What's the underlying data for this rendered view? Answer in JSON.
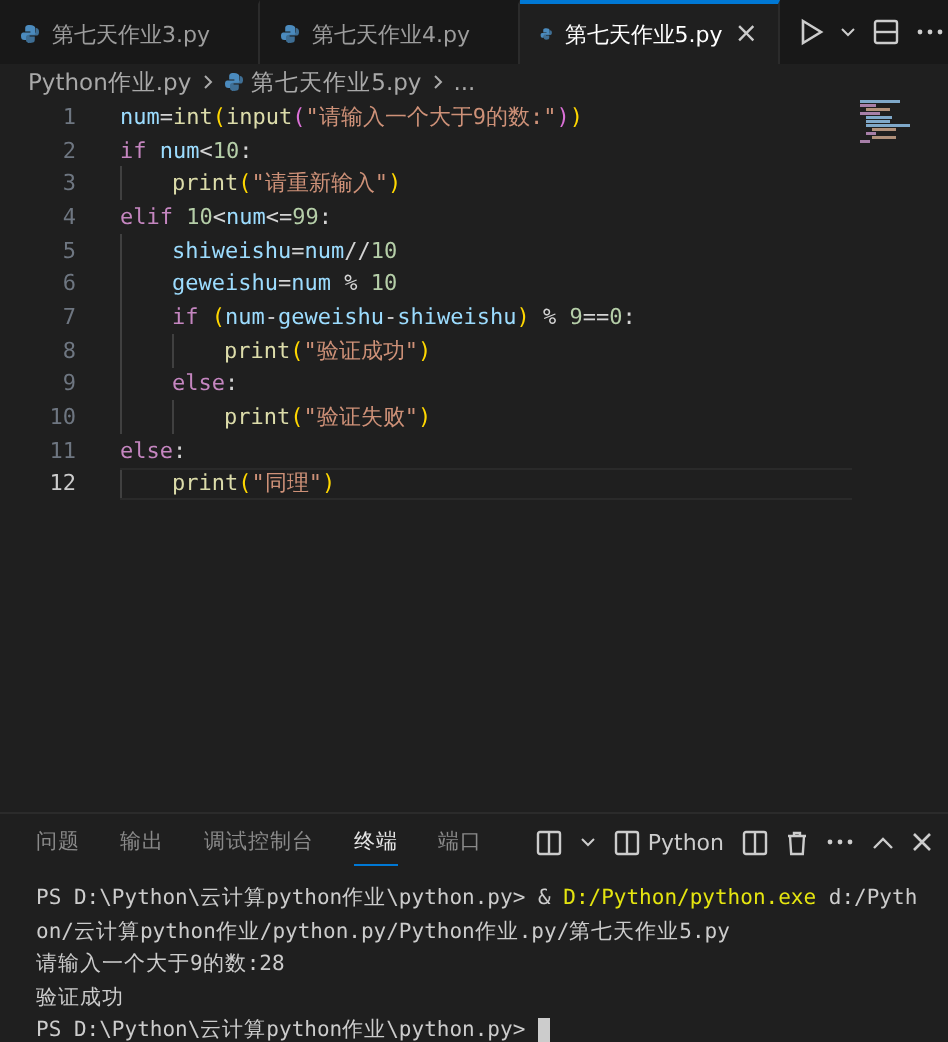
{
  "editor_tabs": [
    {
      "label": "第七天作业3.py",
      "selected": false
    },
    {
      "label": "第七天作业4.py",
      "selected": false
    },
    {
      "label": "第七天作业5.py",
      "selected": true,
      "close": "×"
    }
  ],
  "breadcrumbs": [
    "Python作业.py",
    "第七天作业5.py",
    "..."
  ],
  "code_lines": [
    {
      "number": "1",
      "current": false,
      "tokens": [
        {
          "kind": "var",
          "text": "num"
        },
        {
          "kind": "op",
          "text": "="
        },
        {
          "kind": "func",
          "text": "int"
        },
        {
          "kind": "p1",
          "text": "("
        },
        {
          "kind": "func",
          "text": "input"
        },
        {
          "kind": "p2",
          "text": "("
        },
        {
          "kind": "str",
          "text": "\"请输入一个大于9的数:\""
        },
        {
          "kind": "p2",
          "text": ")"
        },
        {
          "kind": "p1",
          "text": ")"
        }
      ]
    },
    {
      "number": "2",
      "current": false,
      "tokens": [
        {
          "kind": "kw",
          "text": "if "
        },
        {
          "kind": "var",
          "text": "num"
        },
        {
          "kind": "op",
          "text": "<"
        },
        {
          "kind": "num",
          "text": "10"
        },
        {
          "kind": "op",
          "text": ":"
        }
      ]
    },
    {
      "number": "3",
      "current": false,
      "tokens": [
        {
          "kind": "func",
          "text": "    print"
        },
        {
          "kind": "p1",
          "text": "("
        },
        {
          "kind": "str",
          "text": "\"请重新输入\""
        },
        {
          "kind": "p1",
          "text": ")"
        }
      ]
    },
    {
      "number": "4",
      "current": false,
      "tokens": [
        {
          "kind": "kw",
          "text": "elif "
        },
        {
          "kind": "num",
          "text": "10"
        },
        {
          "kind": "op",
          "text": "<"
        },
        {
          "kind": "var",
          "text": "num"
        },
        {
          "kind": "op",
          "text": "<="
        },
        {
          "kind": "num",
          "text": "99"
        },
        {
          "kind": "op",
          "text": ":"
        }
      ]
    },
    {
      "number": "5",
      "current": false,
      "tokens": [
        {
          "kind": "var",
          "text": "    shiweishu"
        },
        {
          "kind": "op",
          "text": "="
        },
        {
          "kind": "var",
          "text": "num"
        },
        {
          "kind": "op",
          "text": "//"
        },
        {
          "kind": "num",
          "text": "10"
        }
      ]
    },
    {
      "number": "6",
      "current": false,
      "tokens": [
        {
          "kind": "var",
          "text": "    geweishu"
        },
        {
          "kind": "op",
          "text": "="
        },
        {
          "kind": "var",
          "text": "num"
        },
        {
          "kind": "op",
          "text": " % "
        },
        {
          "kind": "num",
          "text": "10"
        }
      ]
    },
    {
      "number": "7",
      "current": false,
      "tokens": [
        {
          "kind": "kw",
          "text": "    if "
        },
        {
          "kind": "p1",
          "text": "("
        },
        {
          "kind": "var",
          "text": "num"
        },
        {
          "kind": "op",
          "text": "-"
        },
        {
          "kind": "var",
          "text": "geweishu"
        },
        {
          "kind": "op",
          "text": "-"
        },
        {
          "kind": "var",
          "text": "shiweishu"
        },
        {
          "kind": "p1",
          "text": ")"
        },
        {
          "kind": "op",
          "text": " % "
        },
        {
          "kind": "num",
          "text": "9"
        },
        {
          "kind": "op",
          "text": "=="
        },
        {
          "kind": "num",
          "text": "0"
        },
        {
          "kind": "op",
          "text": ":"
        }
      ]
    },
    {
      "number": "8",
      "current": false,
      "tokens": [
        {
          "kind": "func",
          "text": "        print"
        },
        {
          "kind": "p1",
          "text": "("
        },
        {
          "kind": "str",
          "text": "\"验证成功\""
        },
        {
          "kind": "p1",
          "text": ")"
        }
      ]
    },
    {
      "number": "9",
      "current": false,
      "tokens": [
        {
          "kind": "kw",
          "text": "    else"
        },
        {
          "kind": "op",
          "text": ":"
        }
      ]
    },
    {
      "number": "10",
      "current": false,
      "tokens": [
        {
          "kind": "func",
          "text": "        print"
        },
        {
          "kind": "p1",
          "text": "("
        },
        {
          "kind": "str",
          "text": "\"验证失败\""
        },
        {
          "kind": "p1",
          "text": ")"
        }
      ]
    },
    {
      "number": "11",
      "current": false,
      "tokens": [
        {
          "kind": "kw",
          "text": "else"
        },
        {
          "kind": "op",
          "text": ":"
        }
      ]
    },
    {
      "number": "12",
      "current": true,
      "tokens": [
        {
          "kind": "func",
          "text": "    print"
        },
        {
          "kind": "p1",
          "text": "("
        },
        {
          "kind": "str",
          "text": "\"同理\""
        },
        {
          "kind": "p1",
          "text": ")"
        }
      ]
    }
  ],
  "panel_tabs": [
    {
      "label": "问题",
      "selected": false
    },
    {
      "label": "输出",
      "selected": false
    },
    {
      "label": "调试控制台",
      "selected": false
    },
    {
      "label": "终端",
      "selected": true
    },
    {
      "label": "端口",
      "selected": false
    }
  ],
  "terminal_name": "Python",
  "terminal_lines": [
    {
      "segments": [
        {
          "kind": "plain",
          "text": "PS D:\\Python\\云计算python作业\\python.py> & "
        },
        {
          "kind": "exe",
          "text": "D:/Python/python.exe"
        },
        {
          "kind": "plain",
          "text": " d:/Pyth"
        }
      ]
    },
    {
      "segments": [
        {
          "kind": "plain",
          "text": "on/云计算python作业/python.py/Python作业.py/第七天作业5.py"
        }
      ]
    },
    {
      "segments": [
        {
          "kind": "plain",
          "text": "请输入一个大于9的数:28"
        }
      ]
    },
    {
      "segments": [
        {
          "kind": "plain",
          "text": "验证成功"
        }
      ]
    },
    {
      "segments": [
        {
          "kind": "plain",
          "text": "PS D:\\Python\\云计算python作业\\python.py> "
        }
      ],
      "cursor": true
    }
  ]
}
